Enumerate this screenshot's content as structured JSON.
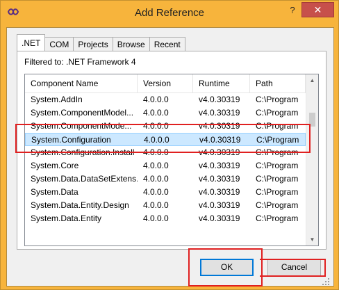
{
  "window": {
    "title": "Add Reference",
    "help_glyph": "?",
    "close_glyph": "✕"
  },
  "tabs": [
    {
      "label": ".NET",
      "active": true
    },
    {
      "label": "COM"
    },
    {
      "label": "Projects"
    },
    {
      "label": "Browse"
    },
    {
      "label": "Recent"
    }
  ],
  "filter_label": "Filtered to: .NET Framework 4",
  "columns": [
    "Component Name",
    "Version",
    "Runtime",
    "Path"
  ],
  "rows": [
    [
      "System.AddIn",
      "4.0.0.0",
      "v4.0.30319",
      "C:\\Program"
    ],
    [
      "System.ComponentModel...",
      "4.0.0.0",
      "v4.0.30319",
      "C:\\Program"
    ],
    [
      "System.ComponentMode...",
      "4.0.0.0",
      "v4.0.30319",
      "C:\\Program"
    ],
    [
      "System.Configuration",
      "4.0.0.0",
      "v4.0.30319",
      "C:\\Program"
    ],
    [
      "System.Configuration.Install",
      "4.0.0.0",
      "v4.0.30319",
      "C:\\Program"
    ],
    [
      "System.Core",
      "4.0.0.0",
      "v4.0.30319",
      "C:\\Program"
    ],
    [
      "System.Data.DataSetExtens...",
      "4.0.0.0",
      "v4.0.30319",
      "C:\\Program"
    ],
    [
      "System.Data",
      "4.0.0.0",
      "v4.0.30319",
      "C:\\Program"
    ],
    [
      "System.Data.Entity.Design",
      "4.0.0.0",
      "v4.0.30319",
      "C:\\Program"
    ],
    [
      "System.Data.Entity",
      "4.0.0.0",
      "v4.0.30319",
      "C:\\Program"
    ],
    [
      "",
      "",
      "",
      ""
    ]
  ],
  "selected_row_index": 3,
  "buttons": {
    "ok": "OK",
    "cancel": "Cancel"
  },
  "colors": {
    "frame": "#f7b43c",
    "close": "#c7504b",
    "selection": "#cce8ff",
    "highlight": "#e02020"
  }
}
